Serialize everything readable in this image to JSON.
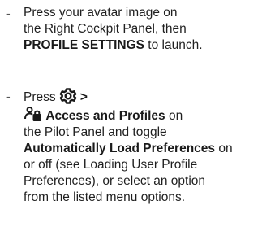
{
  "instructions": [
    {
      "lines": [
        "Press your avatar image on",
        "the Right Cockpit Panel, then"
      ],
      "line3_bold": "PROFILE SETTINGS",
      "line3_rest": " to launch."
    },
    {
      "line1_prefix": "Press",
      "line1_suffix": " >",
      "line2_bold": "Access and Profiles",
      "line2_rest": " on",
      "line3": "the Pilot Panel and toggle",
      "line4_bold": "Automatically Load Preferences",
      "line4_rest": " on",
      "lines_tail": [
        "or off (see Loading User Profile",
        "Preferences), or select an option",
        "from the listed menu options."
      ]
    }
  ],
  "bullet_char": "-",
  "icons": {
    "settings": "gear-icon",
    "access": "user-lock-icon"
  }
}
